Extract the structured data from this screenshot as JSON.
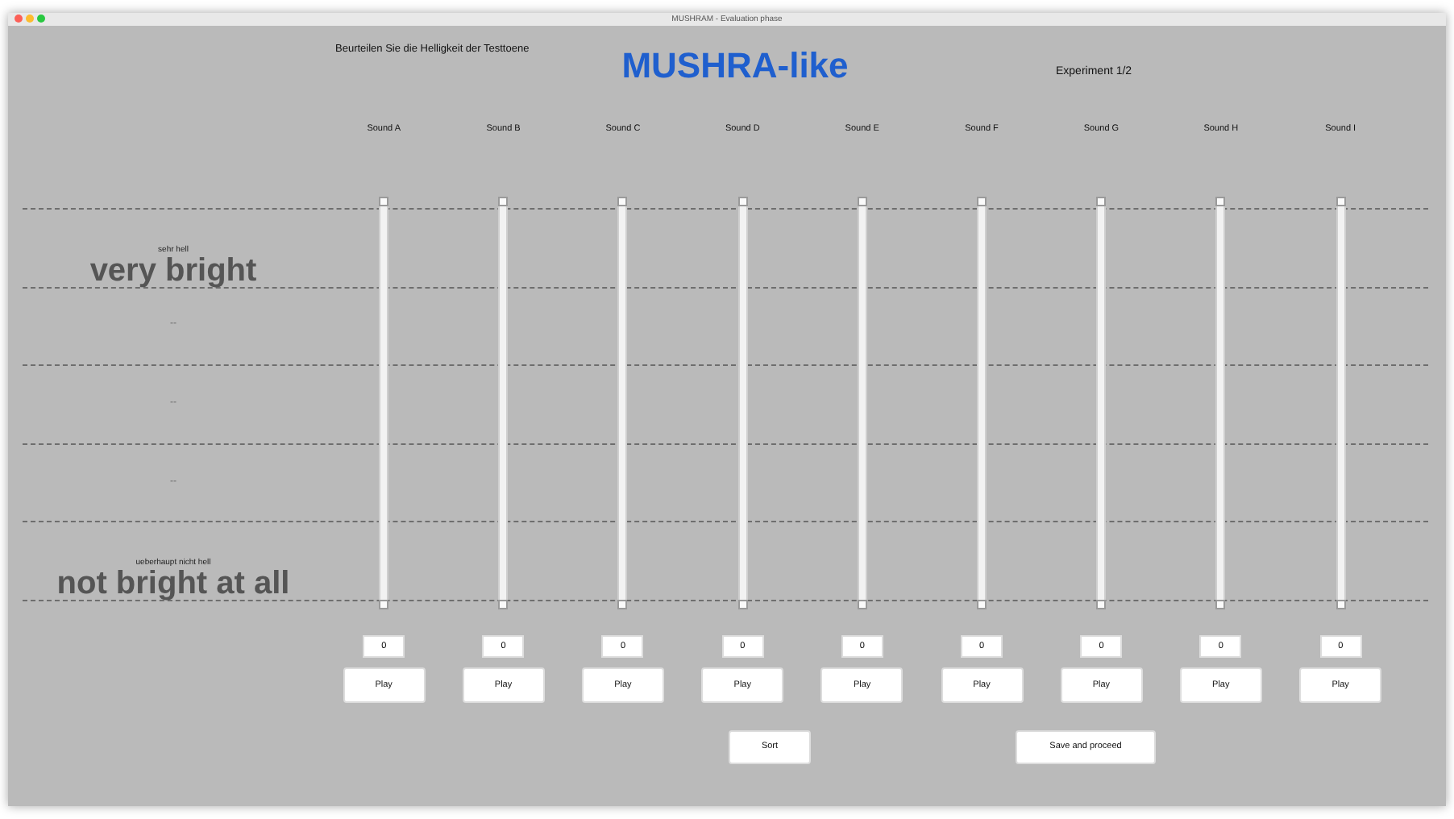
{
  "window": {
    "title": "MUSHRAM - Evaluation phase"
  },
  "instruction": "Beurteilen Sie die Helligkeit der Testtoene",
  "title": "MUSHRA-like",
  "experiment": "Experiment 1/2",
  "scale": [
    {
      "kind": "anchor",
      "sub": "sehr hell",
      "main": "very bright"
    },
    {
      "kind": "tick",
      "main": "--"
    },
    {
      "kind": "tick",
      "main": "--"
    },
    {
      "kind": "tick",
      "main": "--"
    },
    {
      "kind": "anchor",
      "sub": "ueberhaupt nicht hell",
      "main": "not bright at all"
    }
  ],
  "sounds": [
    {
      "name": "Sound A",
      "level": 0,
      "value": "0",
      "play": "Play"
    },
    {
      "name": "Sound B",
      "level": 0,
      "value": "0",
      "play": "Play"
    },
    {
      "name": "Sound C",
      "level": 0,
      "value": "0",
      "play": "Play"
    },
    {
      "name": "Sound D",
      "level": 0,
      "value": "0",
      "play": "Play"
    },
    {
      "name": "Sound E",
      "level": 0,
      "value": "0",
      "play": "Play"
    },
    {
      "name": "Sound F",
      "level": 0,
      "value": "0",
      "play": "Play"
    },
    {
      "name": "Sound G",
      "level": 0,
      "value": "0",
      "play": "Play"
    },
    {
      "name": "Sound H",
      "level": 0,
      "value": "0",
      "play": "Play"
    },
    {
      "name": "Sound I",
      "level": 0,
      "value": "0",
      "play": "Play"
    }
  ],
  "buttons": [
    {
      "label": "Sort"
    },
    {
      "label": "Save and proceed"
    }
  ]
}
